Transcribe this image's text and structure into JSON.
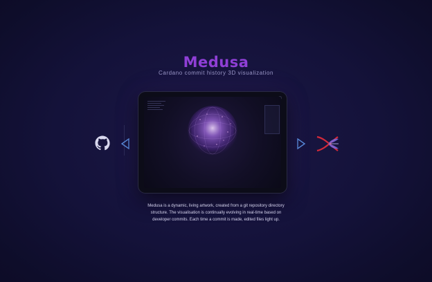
{
  "header": {
    "title": "Medusa",
    "subtitle": "Cardano commit history 3D visualization"
  },
  "icons": {
    "left_brand": "github-icon",
    "right_brand": "cardano-x-icon",
    "nav_prev": "chevron-left-icon",
    "nav_next": "chevron-right-icon"
  },
  "description": "Medusa is a dynamic, living artwork, created from a git repository directory structure. The visualisation is continually evolving in real-time based on developer commits. Each time a commit is made, edited files light up.",
  "colors": {
    "accent": "#8f3fd6",
    "nav": "#5b8fe0",
    "brand_red": "#d42a3a"
  }
}
